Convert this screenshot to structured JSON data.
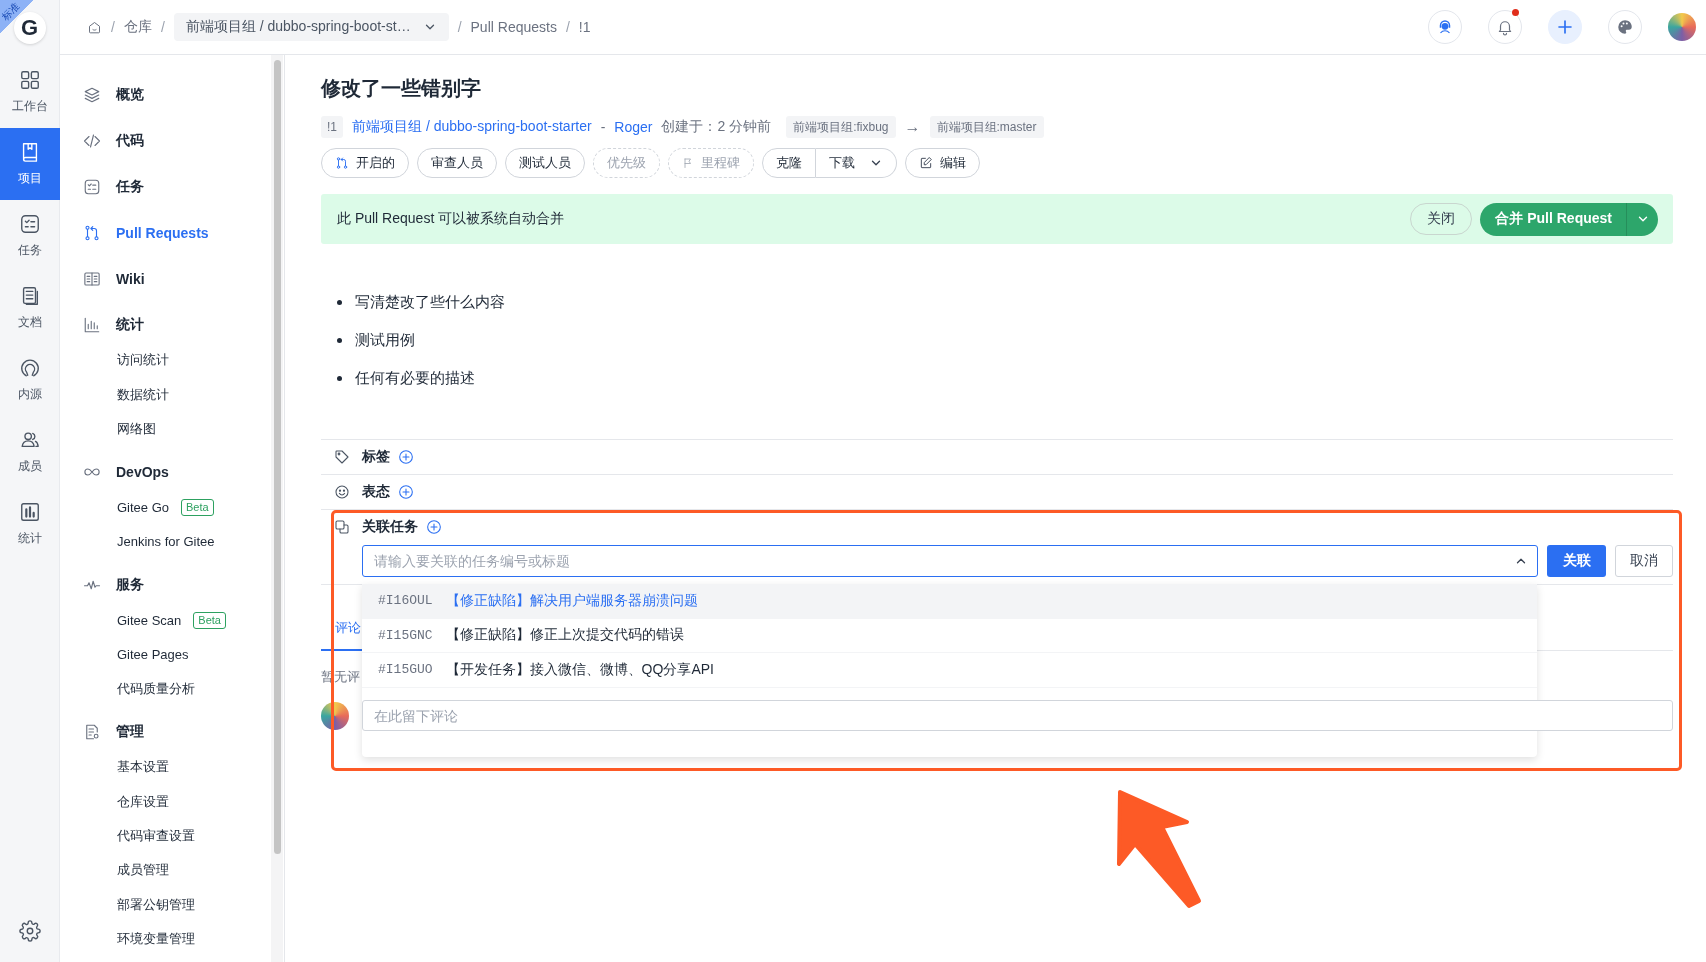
{
  "rail": {
    "badge": "标准",
    "logo": "G",
    "items": [
      {
        "label": "工作台",
        "selected": false
      },
      {
        "label": "项目",
        "selected": true
      },
      {
        "label": "任务",
        "selected": false
      },
      {
        "label": "文档",
        "selected": false
      },
      {
        "label": "内源",
        "selected": false
      },
      {
        "label": "成员",
        "selected": false
      },
      {
        "label": "统计",
        "selected": false
      }
    ]
  },
  "topbar": {
    "separator": "/",
    "breadcrumb": [
      {
        "kind": "home"
      },
      {
        "kind": "link",
        "label": "仓库"
      },
      {
        "kind": "select",
        "label": "前端项目组 / dubbo-spring-boot-st…"
      },
      {
        "kind": "link",
        "label": "Pull Requests"
      },
      {
        "kind": "current",
        "label": "!1"
      }
    ],
    "bell_unread": true
  },
  "sidebar": {
    "items": [
      {
        "label": "概览",
        "selected": false
      },
      {
        "label": "代码",
        "selected": false
      },
      {
        "label": "任务",
        "selected": false
      },
      {
        "label": "Pull Requests",
        "selected": true
      },
      {
        "label": "Wiki",
        "selected": false
      },
      {
        "label": "统计",
        "selected": false,
        "children": [
          {
            "label": "访问统计",
            "selected": false
          },
          {
            "label": "数据统计",
            "selected": false
          },
          {
            "label": "网络图",
            "selected": false
          }
        ]
      },
      {
        "label": "DevOps",
        "selected": false,
        "children": [
          {
            "label": "Gitee Go",
            "badge": "Beta",
            "selected": false
          },
          {
            "label": "Jenkins for Gitee",
            "selected": false
          }
        ]
      },
      {
        "label": "服务",
        "selected": false,
        "children": [
          {
            "label": "Gitee Scan",
            "badge": "Beta",
            "selected": false
          },
          {
            "label": "Gitee Pages",
            "selected": false
          },
          {
            "label": "代码质量分析",
            "selected": false
          }
        ]
      },
      {
        "label": "管理",
        "selected": false,
        "children": [
          {
            "label": "基本设置",
            "selected": false
          },
          {
            "label": "仓库设置",
            "selected": false
          },
          {
            "label": "代码审查设置",
            "selected": false
          },
          {
            "label": "成员管理",
            "selected": false
          },
          {
            "label": "部署公钥管理",
            "selected": false
          },
          {
            "label": "环境变量管理",
            "selected": false
          }
        ]
      }
    ]
  },
  "pull_request": {
    "title": "修改了一些错别字",
    "number": "!1",
    "repo": "前端项目组 / dubbo-spring-boot-starter",
    "separator": "-",
    "author": "Roger",
    "created": "创建于：2 分钟前",
    "source_branch": "前端项目组:fixbug",
    "arrow": "→",
    "target_branch": "前端项目组:master",
    "actions": [
      {
        "kind": "status",
        "label": "开启的"
      },
      {
        "kind": "plain",
        "label": "审查人员"
      },
      {
        "kind": "plain",
        "label": "测试人员"
      },
      {
        "kind": "empty",
        "label": "优先级"
      },
      {
        "kind": "milestone",
        "label": "里程碑"
      },
      {
        "kind": "split",
        "label": "克隆",
        "menu_label": "下载"
      },
      {
        "kind": "edit",
        "label": "编辑"
      }
    ]
  },
  "merge_banner": {
    "text": "此 Pull Request 可以被系统自动合并",
    "close": "关闭",
    "merge": "合并 Pull Request"
  },
  "description": [
    "写清楚改了些什么内容",
    "测试用例",
    "任何有必要的描述"
  ],
  "meta_rows": [
    {
      "label": "标签"
    },
    {
      "label": "表态"
    }
  ],
  "linked_tasks": {
    "label": "关联任务",
    "search": {
      "placeholder": "请输入要关联的任务编号或标题"
    },
    "confirm": "关联",
    "cancel": "取消",
    "options": [
      {
        "id": "#I16OUL",
        "title": "【修正缺陷】解决用户端服务器崩溃问题",
        "selected": true
      },
      {
        "id": "#I15GNC",
        "title": "【修正缺陷】修正上次提交代码的错误",
        "selected": false
      },
      {
        "id": "#I15GUO",
        "title": "【开发任务】接入微信、微博、QQ分享API",
        "selected": false
      }
    ]
  },
  "comments": {
    "tabs": [
      {
        "label": "评论",
        "selected": true
      }
    ],
    "empty_text": "暂无评",
    "input": {
      "placeholder": "在此留下评论"
    }
  }
}
